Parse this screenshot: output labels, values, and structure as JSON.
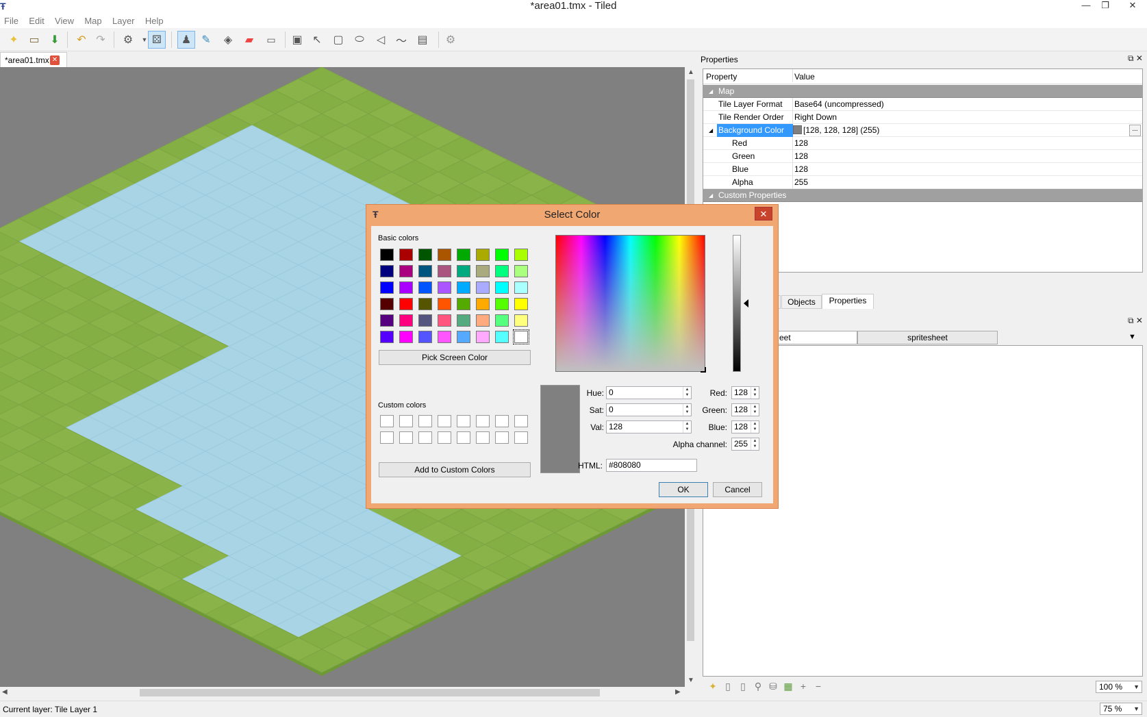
{
  "window": {
    "title": "*area01.tmx - Tiled",
    "minimize": "—",
    "maximize": "❐",
    "close": "✕"
  },
  "menu": [
    "File",
    "Edit",
    "View",
    "Map",
    "Layer",
    "Help"
  ],
  "document_tab": {
    "label": "*area01.tmx",
    "close": "✕"
  },
  "properties_panel": {
    "title": "Properties",
    "header": {
      "property": "Property",
      "value": "Value"
    },
    "map_group": "Map",
    "rows": [
      {
        "name": "Tile Layer Format",
        "value": "Base64 (uncompressed)"
      },
      {
        "name": "Tile Render Order",
        "value": "Right Down"
      }
    ],
    "background_color": {
      "name": "Background Color",
      "value": "[128, 128, 128] (255)",
      "color": "#808080",
      "edit_button": "..."
    },
    "color_rows": [
      {
        "name": "Red",
        "value": "128"
      },
      {
        "name": "Green",
        "value": "128"
      },
      {
        "name": "Blue",
        "value": "128"
      },
      {
        "name": "Alpha",
        "value": "255"
      }
    ],
    "custom_group": "Custom Properties"
  },
  "dock_tabs": [
    "Objects",
    "Properties"
  ],
  "tileset_tabs": [
    "eet",
    "spritesheet"
  ],
  "status": {
    "text": "Current layer: Tile Layer 1",
    "zoom_tileset": "100 %",
    "zoom_map": "75 %"
  },
  "colors": {
    "grass_top": "#8ab44a",
    "grass_dark": "#6d9a34",
    "grass_side": "#c98a5a",
    "water_top": "#a8d4e6",
    "water_side": "#5fb7d8",
    "canvas": "#808080",
    "dialog_frame": "#f0a772",
    "accent_blue": "#3399ff"
  },
  "select_color_dialog": {
    "title": "Select Color",
    "close": "✕",
    "basic_colors_label": "Basic colors",
    "basic_colors": [
      "#000000",
      "#aa0000",
      "#005500",
      "#aa5500",
      "#00aa00",
      "#aaaa00",
      "#00ff00",
      "#aaff00",
      "#00007f",
      "#aa007f",
      "#00557f",
      "#aa557f",
      "#00aa7f",
      "#aaaa7f",
      "#00ff7f",
      "#aaff7f",
      "#0000ff",
      "#aa00ff",
      "#0055ff",
      "#aa55ff",
      "#00aaff",
      "#aaaaff",
      "#00ffff",
      "#aaffff",
      "#550000",
      "#ff0000",
      "#555500",
      "#ff5500",
      "#55aa00",
      "#ffaa00",
      "#55ff00",
      "#ffff00",
      "#55007f",
      "#ff007f",
      "#55557f",
      "#ff557f",
      "#55aa7f",
      "#ffaa7f",
      "#55ff7f",
      "#ffff7f",
      "#5500ff",
      "#ff00ff",
      "#5555ff",
      "#ff55ff",
      "#55aaff",
      "#ffaaff",
      "#55ffff",
      "#ffffff"
    ],
    "pick_screen_color": "Pick Screen Color",
    "custom_colors_label": "Custom colors",
    "add_custom": "Add to Custom Colors",
    "fields": {
      "hue_label": "Hue:",
      "hue": "0",
      "sat_label": "Sat:",
      "sat": "0",
      "val_label": "Val:",
      "val": "128",
      "red_label": "Red:",
      "red": "128",
      "green_label": "Green:",
      "green": "128",
      "blue_label": "Blue:",
      "blue": "128",
      "alpha_label": "Alpha channel:",
      "alpha": "255",
      "html_label": "HTML:",
      "html": "#808080"
    },
    "ok": "OK",
    "cancel": "Cancel",
    "current_color": "#808080"
  }
}
